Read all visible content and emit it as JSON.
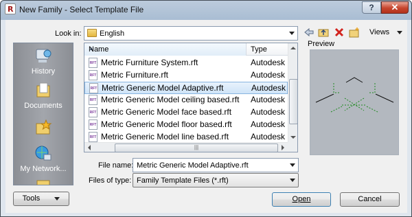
{
  "window": {
    "title": "New Family - Select Template File",
    "app_icon": "revit-icon",
    "help_label": "?",
    "close_label": "✕"
  },
  "look_in": {
    "label": "Look in:",
    "value": "English"
  },
  "toolbar": {
    "back_icon": "back-arrow-icon",
    "up_icon": "up-folder-icon",
    "delete_icon": "delete-icon",
    "new_folder_icon": "new-folder-icon",
    "views_label": "Views"
  },
  "places": [
    {
      "label": "History",
      "icon": "history-icon"
    },
    {
      "label": "Documents",
      "icon": "documents-icon"
    },
    {
      "label": "",
      "icon": "favorites-folder-icon"
    },
    {
      "label": "My Network...",
      "icon": "network-icon"
    }
  ],
  "file_list": {
    "columns": [
      "Name",
      "Type"
    ],
    "rows": [
      {
        "name": "Metric Furniture System.rft",
        "type": "Autodesk R"
      },
      {
        "name": "Metric Furniture.rft",
        "type": "Autodesk R"
      },
      {
        "name": "Metric Generic Model Adaptive.rft",
        "type": "Autodesk R",
        "selected": true
      },
      {
        "name": "Metric Generic Model ceiling based.rft",
        "type": "Autodesk R"
      },
      {
        "name": "Metric Generic Model face based.rft",
        "type": "Autodesk R"
      },
      {
        "name": "Metric Generic Model floor based.rft",
        "type": "Autodesk R"
      },
      {
        "name": "Metric Generic Model line based.rft",
        "type": "Autodesk R"
      }
    ],
    "file_icon_text": "RFT"
  },
  "preview": {
    "label": "Preview"
  },
  "file_name": {
    "label": "File name:",
    "value": "Metric Generic Model Adaptive.rft"
  },
  "files_of_type": {
    "label": "Files of type:",
    "value": "Family Template Files  (*.rft)"
  },
  "buttons": {
    "tools": "Tools",
    "open": "Open",
    "cancel": "Cancel"
  },
  "colors": {
    "title_bar": "#b7c8da",
    "selection": "#cfe4f8",
    "places_bar": "#9a9da3",
    "preview_bg": "#b3b8bf",
    "close_button": "#c7452d"
  }
}
